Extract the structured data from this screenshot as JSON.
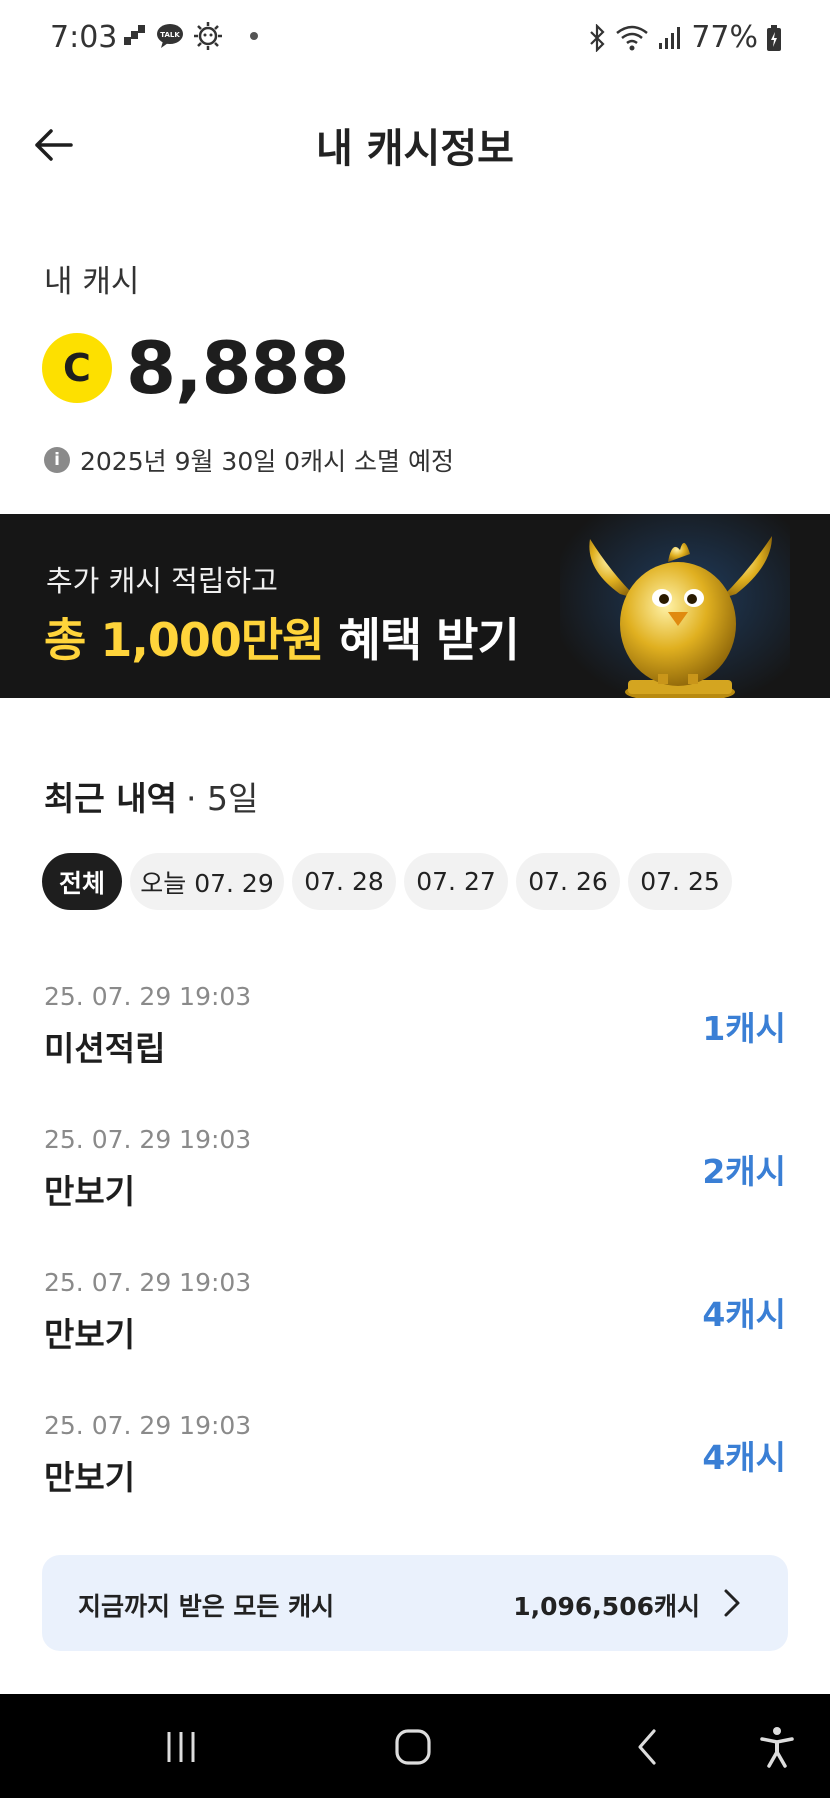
{
  "status_bar": {
    "time": "7:03",
    "battery": "77%",
    "icons_left": [
      "signal-bars-icon",
      "talk-icon",
      "sun-face-icon",
      "dot-icon"
    ],
    "icons_right": [
      "bluetooth-icon",
      "wifi-icon",
      "cell-signal-icon",
      "battery-icon"
    ]
  },
  "header": {
    "title": "내 캐시정보",
    "back_icon": "arrow-left-icon"
  },
  "cash": {
    "label": "내 캐시",
    "coin_symbol": "C",
    "amount": "8,888",
    "expire_notice": "2025년 9월 30일 0캐시 소멸 예정",
    "info_symbol": "i"
  },
  "banner": {
    "subtitle": "추가 캐시 적립하고",
    "highlight": "총 1,000만원",
    "rest": " 혜택 받기",
    "art": "golden-chick-trophy"
  },
  "recent": {
    "title": "최근 내역",
    "days": "· 5일",
    "chips": [
      {
        "label": "전체",
        "active": true
      },
      {
        "label": "오늘 07. 29",
        "active": false
      },
      {
        "label": "07. 28",
        "active": false
      },
      {
        "label": "07. 27",
        "active": false
      },
      {
        "label": "07. 26",
        "active": false
      },
      {
        "label": "07. 25",
        "active": false
      }
    ],
    "items": [
      {
        "date": "25. 07. 29 19:03",
        "title": "미션적립",
        "amount": "1캐시"
      },
      {
        "date": "25. 07. 29 19:03",
        "title": "만보기",
        "amount": "2캐시"
      },
      {
        "date": "25. 07. 29 19:03",
        "title": "만보기",
        "amount": "4캐시"
      },
      {
        "date": "25. 07. 29 19:03",
        "title": "만보기",
        "amount": "4캐시"
      }
    ]
  },
  "total": {
    "label": "지금까지 받은 모든 캐시",
    "value": "1,096,506캐시"
  },
  "nav_bar": {
    "buttons": [
      "recents-icon",
      "home-icon",
      "back-icon",
      "accessibility-icon"
    ]
  },
  "colors": {
    "accent_blue": "#3a7fd5",
    "coin_yellow": "#fde000",
    "banner_bg": "#161616",
    "highlight_yellow": "#ffd43b",
    "total_bg": "#eaf1fc"
  }
}
